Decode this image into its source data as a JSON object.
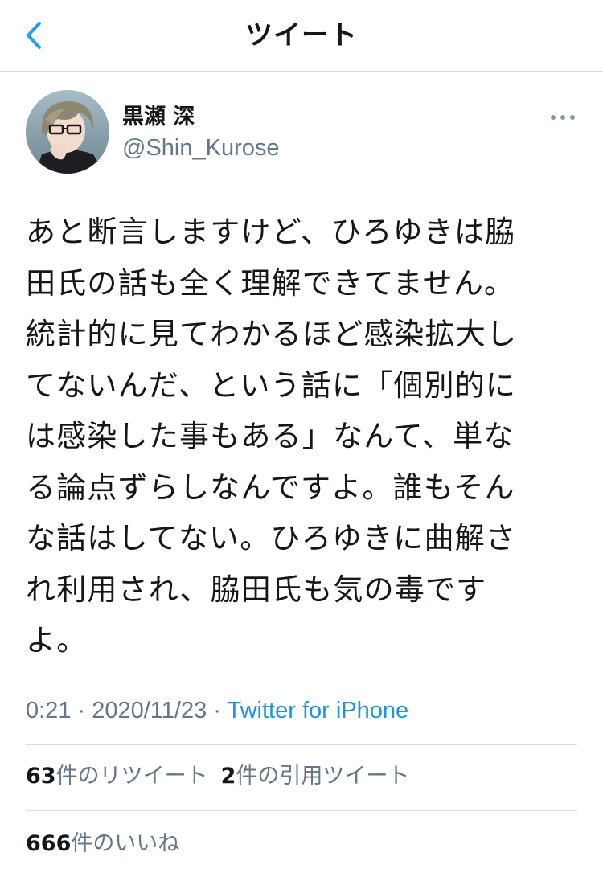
{
  "header": {
    "title": "ツイート",
    "back_icon": "chevron-left-icon",
    "accent_color": "#1da1f2"
  },
  "author": {
    "name": "黒瀬 深",
    "handle": "@Shin_Kurose",
    "more_icon": "more-horizontal-icon"
  },
  "tweet": {
    "lines": [
      "あと断言しますけど、ひろゆきは脇",
      "田氏の話も全く理解できてません。",
      "統計的に見てわかるほど感染拡大し",
      "てないんだ、という話に「個別的に",
      "は感染した事もある」なんて、単な",
      "る論点ずらしなんですよ。誰もそん",
      "な話はしてない。ひろゆきに曲解さ",
      "れ利用され、脇田氏も気の毒です",
      "よ。"
    ],
    "time": "0:21",
    "sep1": " · ",
    "date": "2020/11/23",
    "sep2": " · ",
    "source": "Twitter for iPhone",
    "source_color": "#1b95e0"
  },
  "stats": {
    "retweets_count": "63",
    "retweets_label": "件のリツイート",
    "quotes_count": "2",
    "quotes_label": "件の引用ツイート",
    "likes_count": "666",
    "likes_label": "件のいいね"
  }
}
